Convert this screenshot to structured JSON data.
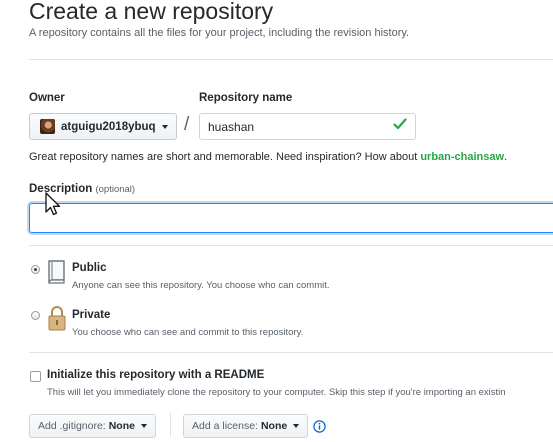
{
  "header": {
    "title": "Create a new repository",
    "subtitle": "A repository contains all the files for your project, including the revision history."
  },
  "owner": {
    "label": "Owner",
    "value": "atguigu2018ybuq"
  },
  "separator": "/",
  "repository": {
    "label": "Repository name",
    "value": "huashan",
    "valid": true
  },
  "hint": {
    "text": "Great repository names are short and memorable. Need inspiration? How about ",
    "suggestion": "urban-chainsaw",
    "suffix": "."
  },
  "description": {
    "label": "Description",
    "optional": "(optional)",
    "value": ""
  },
  "visibility": {
    "selected": "public",
    "options": [
      {
        "id": "public",
        "title": "Public",
        "desc": "Anyone can see this repository. You choose who can commit."
      },
      {
        "id": "private",
        "title": "Private",
        "desc": "You choose who can see and commit to this repository."
      }
    ]
  },
  "init_readme": {
    "label": "Initialize this repository with a README",
    "desc": "This will let you immediately clone the repository to your computer. Skip this step if you're importing an existin",
    "checked": false
  },
  "gitignore": {
    "label": "Add .gitignore:",
    "value": "None"
  },
  "license": {
    "label": "Add a license:",
    "value": "None"
  },
  "colors": {
    "accent_green": "#28a745",
    "focus_blue": "#2188ff",
    "info_blue": "#0366d6"
  },
  "icons": [
    "check-icon",
    "repo-book-icon",
    "lock-icon",
    "info-icon",
    "caret-down-icon",
    "mouse-cursor-icon"
  ]
}
